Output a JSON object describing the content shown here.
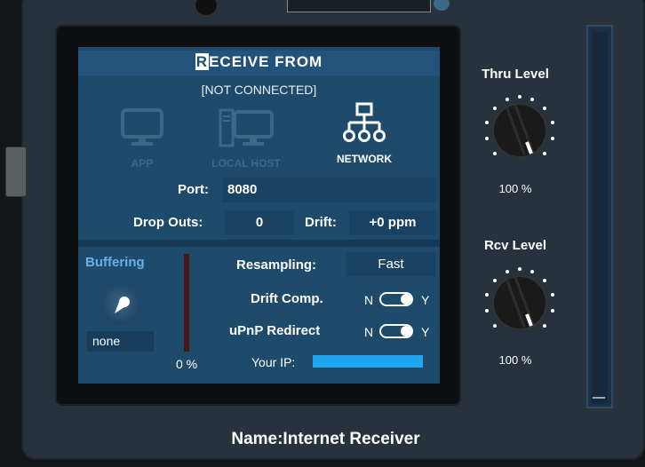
{
  "top": {
    "field_label": ""
  },
  "receiver": {
    "title_first": "R",
    "title_rest": "ECEIVE FROM",
    "status": "[NOT CONNECTED]",
    "modes": [
      {
        "label": "APP",
        "icon": "monitor-icon",
        "selected": false
      },
      {
        "label": "LOCAL HOST",
        "icon": "desktop-computer-icon",
        "selected": false
      },
      {
        "label": "NETWORK",
        "icon": "network-icon",
        "selected": true
      }
    ],
    "port_label": "Port:",
    "port_value": "8080",
    "dropouts_label": "Drop Outs:",
    "dropouts_value": "0",
    "drift_label": "Drift:",
    "drift_value": "+0 ppm"
  },
  "buffering": {
    "label": "Buffering",
    "value": "none",
    "meter_pct": "0 %"
  },
  "settings": {
    "resampling_label": "Resampling:",
    "resampling_value": "Fast",
    "drift_comp_label": "Drift Comp.",
    "drift_comp_n": "N",
    "drift_comp_y": "Y",
    "drift_comp_on": true,
    "upnp_label": "uPnP Redirect",
    "upnp_n": "N",
    "upnp_y": "Y",
    "upnp_on": true,
    "your_ip_label": "Your IP:"
  },
  "knobs": {
    "thru_label": "Thru Level",
    "thru_value": "100 %",
    "rcv_label": "Rcv Level",
    "rcv_value": "100 %"
  },
  "footer": {
    "name": "Name:Internet Receiver"
  },
  "colors": {
    "screen": "#1e4a6b",
    "accent": "#1ea7f0",
    "meter_red": "#4a1515"
  }
}
